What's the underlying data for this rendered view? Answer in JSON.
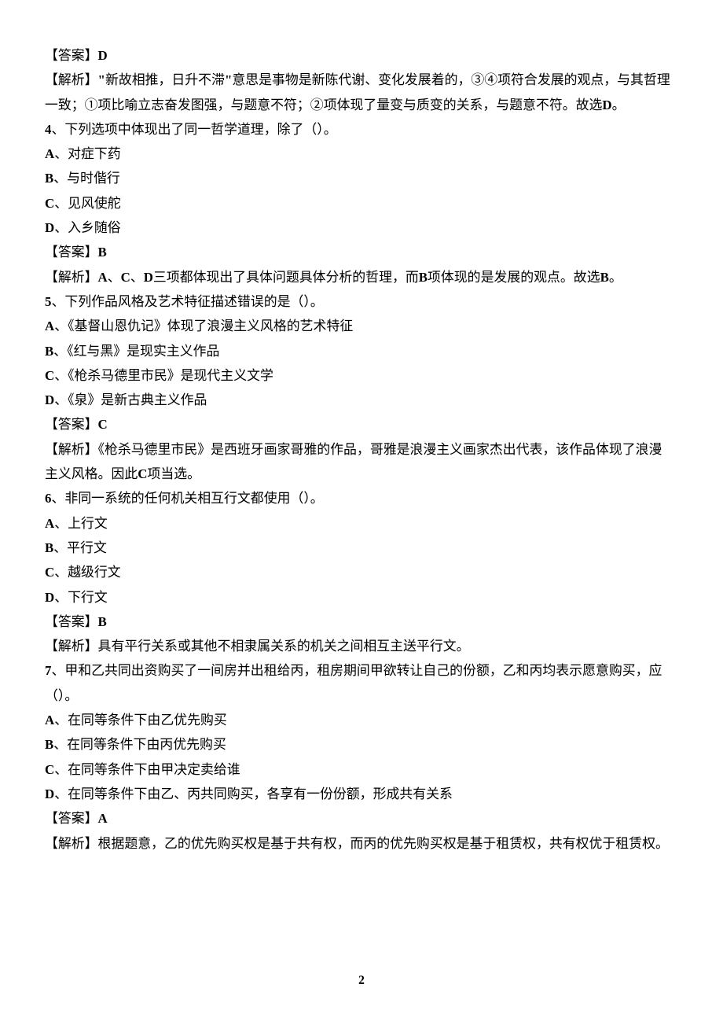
{
  "lines": {
    "q3_answer": "【答案】D",
    "q3_expl_1": "【解析】\"新故相推，日升不滞\"意思是事物是新陈代谢、变化发展着的，③④项符合发展的观点，与其哲理",
    "q3_expl_2": "一致；①项比喻立志奋发图强，与题意不符；②项体现了量变与质变的关系，与题意不符。故选D。",
    "q4_stem": "4、下列选项中体现出了同一哲学道理，除了（）。",
    "q4_a": "A、对症下药",
    "q4_b": "B、与时偕行",
    "q4_c": "C、见风使舵",
    "q4_d": "D、入乡随俗",
    "q4_answer": "【答案】B",
    "q4_expl": "【解析】A、C、D三项都体现出了具体问题具体分析的哲理，而B项体现的是发展的观点。故选B。",
    "q5_stem": "5、下列作品风格及艺术特征描述错误的是（）。",
    "q5_a": "A、《基督山恩仇记》体现了浪漫主义风格的艺术特征",
    "q5_b": "B、《红与黑》是现实主义作品",
    "q5_c": "C、《枪杀马德里市民》是现代主义文学",
    "q5_d": "D、《泉》是新古典主义作品",
    "q5_answer": "【答案】C",
    "q5_expl_1": "【解析】《枪杀马德里市民》是西班牙画家哥雅的作品，哥雅是浪漫主义画家杰出代表，该作品体现了浪漫",
    "q5_expl_2": "主义风格。因此C项当选。",
    "q6_stem": "6、非同一系统的任何机关相互行文都使用（）。",
    "q6_a": "A、上行文",
    "q6_b": "B、平行文",
    "q6_c": "C、越级行文",
    "q6_d": "D、下行文",
    "q6_answer": "【答案】B",
    "q6_expl": "【解析】具有平行关系或其他不相隶属关系的机关之间相互主送平行文。",
    "q7_stem_1": "7、甲和乙共同出资购买了一间房并出租给丙，租房期间甲欲转让自己的份额，乙和丙均表示愿意购买，应",
    "q7_stem_2": "（）。",
    "q7_a": "A、在同等条件下由乙优先购买",
    "q7_b": "B、在同等条件下由丙优先购买",
    "q7_c": "C、在同等条件下由甲决定卖给谁",
    "q7_d": "D、在同等条件下由乙、丙共同购买，各享有一份份额，形成共有关系",
    "q7_answer": "【答案】A",
    "q7_expl": "【解析】根据题意，乙的优先购买权是基于共有权，而丙的优先购买权是基于租赁权，共有权优于租赁权。"
  },
  "page_number": "2"
}
